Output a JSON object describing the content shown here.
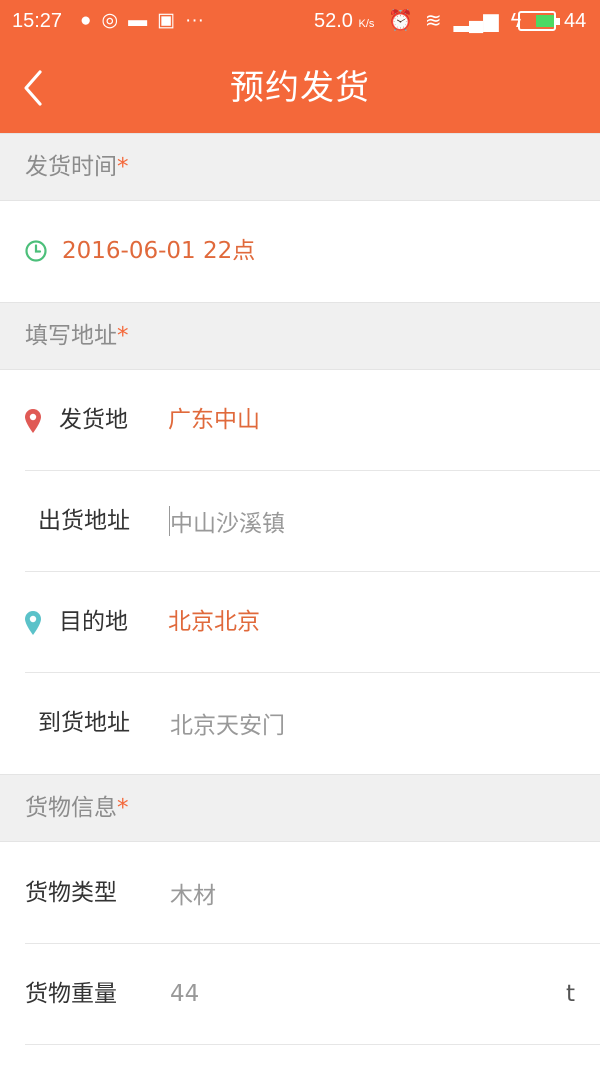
{
  "status_bar": {
    "time": "15:27",
    "network_speed": "52.0",
    "network_unit": "K/s",
    "battery_level": "44"
  },
  "nav": {
    "title": "预约发货"
  },
  "sections": {
    "time": {
      "title": "发货时间",
      "required_mark": "*"
    },
    "address": {
      "title": "填写地址",
      "required_mark": "*"
    },
    "cargo": {
      "title": "货物信息",
      "required_mark": "*"
    }
  },
  "ship_time": {
    "value": "2016-06-01  22点"
  },
  "address": {
    "origin_label": "发货地",
    "origin_value": "广东中山",
    "ship_address_label": "出货地址",
    "ship_address_value": "中山沙溪镇",
    "destination_label": "目的地",
    "destination_value": "北京北京",
    "arrival_address_label": "到货地址",
    "arrival_address_value": "北京天安门"
  },
  "cargo": {
    "type_label": "货物类型",
    "type_value": "木材",
    "weight_label": "货物重量",
    "weight_value": "44",
    "weight_unit": "t"
  },
  "colors": {
    "accent": "#f4683a",
    "value_orange": "#e0693b",
    "clock_green": "#4cbf7a",
    "origin_pin_red": "#e05a55",
    "destination_pin_teal": "#5bc2c9"
  }
}
